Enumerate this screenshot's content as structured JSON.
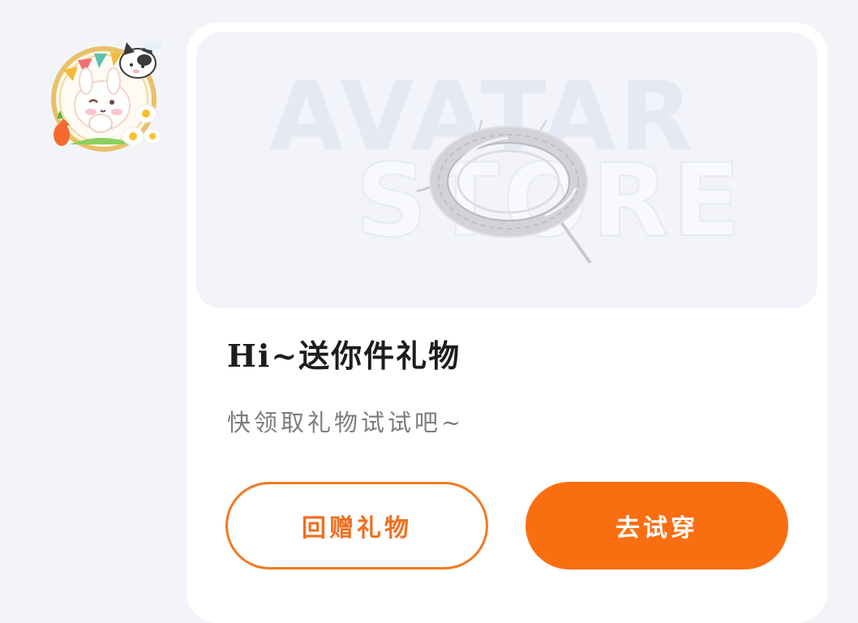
{
  "avatar": {
    "icon": "cartoon-avatar-with-frame"
  },
  "card": {
    "banner": {
      "watermark_line1": "AVATAR",
      "watermark_line2": "STORE",
      "item_icon": "ring-halo-icon"
    },
    "title": "Hi~送你件礼物",
    "subtitle": "快领取礼物试试吧~",
    "buttons": {
      "return_gift": "回赠礼物",
      "try_on": "去试穿"
    }
  },
  "colors": {
    "background": "#f3f4f8",
    "accent": "#fa6e12",
    "outline": "#f07a24",
    "banner": "#f2f4fa"
  }
}
